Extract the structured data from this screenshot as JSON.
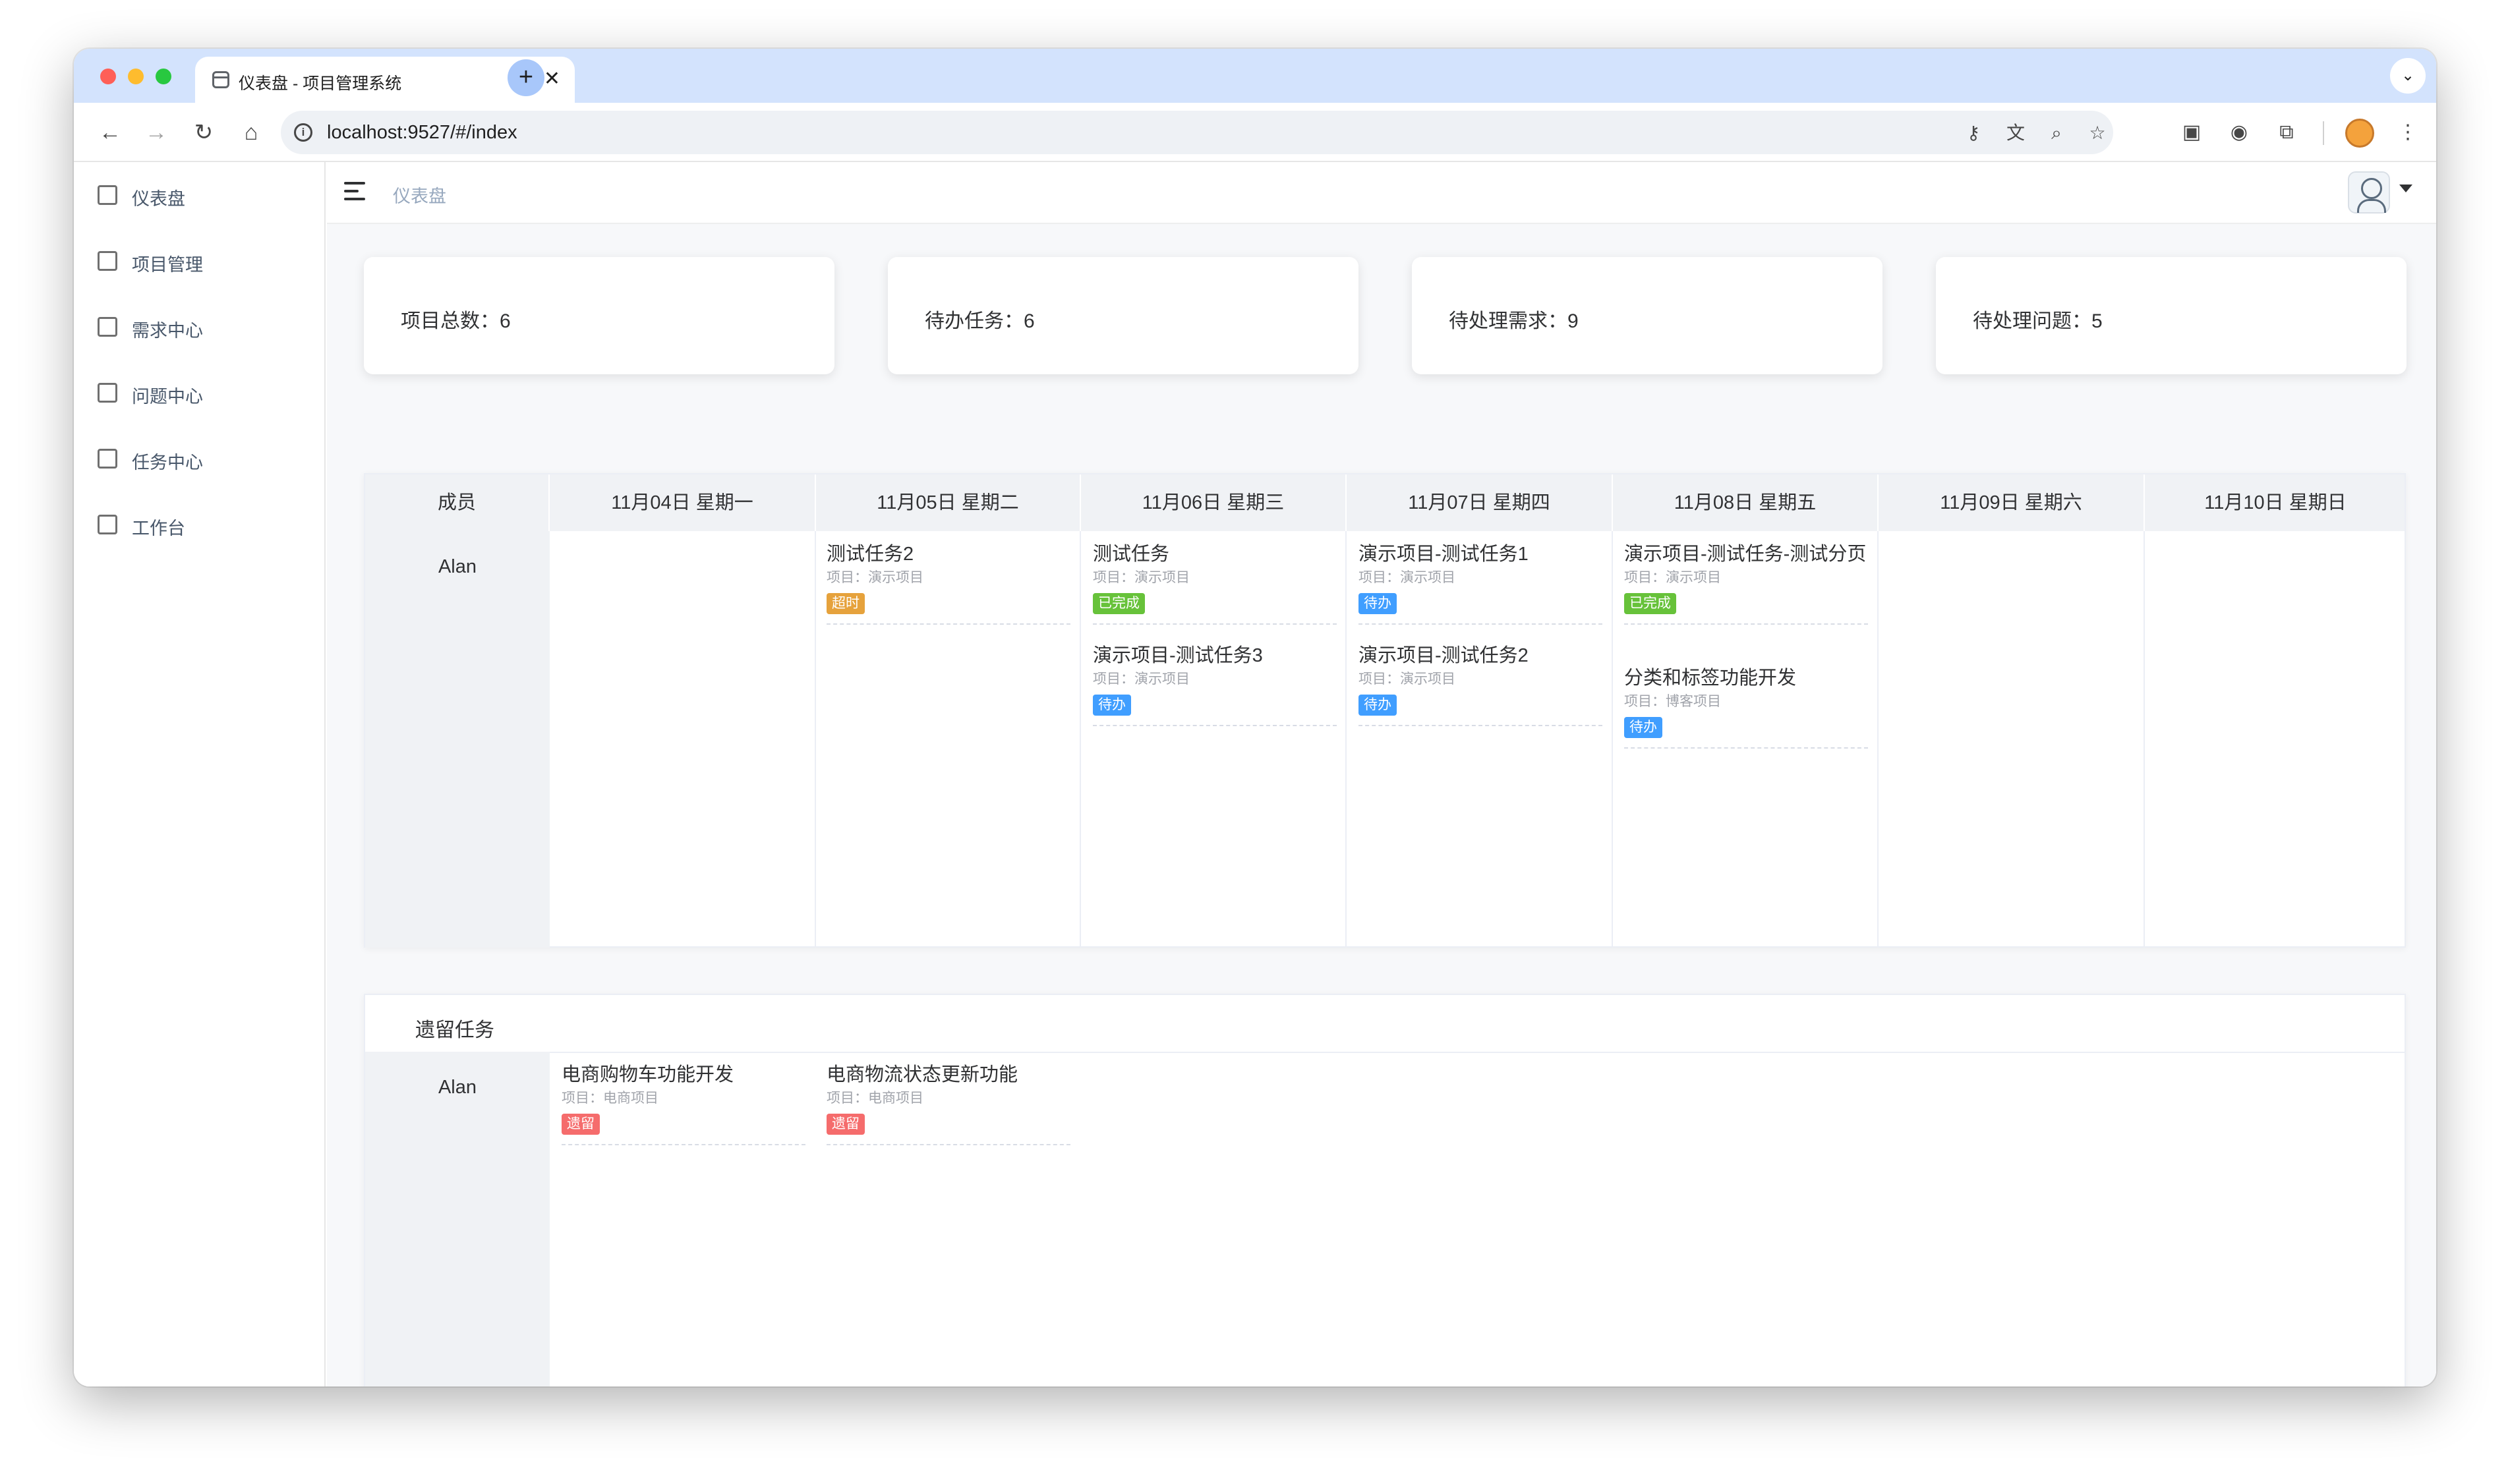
{
  "browser": {
    "tab_title": "仪表盘 - 项目管理系统",
    "url": "localhost:9527/#/index"
  },
  "sidebar": {
    "items": [
      {
        "label": "仪表盘",
        "icon": "dashboard-icon"
      },
      {
        "label": "项目管理",
        "icon": "briefcase-icon"
      },
      {
        "label": "需求中心",
        "icon": "archive-icon"
      },
      {
        "label": "问题中心",
        "icon": "document-icon"
      },
      {
        "label": "任务中心",
        "icon": "copy-icon"
      },
      {
        "label": "工作台",
        "icon": "workbench-icon"
      }
    ]
  },
  "navbar": {
    "breadcrumb": "仪表盘"
  },
  "stats": [
    {
      "label": "项目总数：6"
    },
    {
      "label": "待办任务：6"
    },
    {
      "label": "待处理需求：9"
    },
    {
      "label": "待处理问题：5"
    }
  ],
  "board": {
    "member_header": "成员",
    "days": [
      "11月04日 星期一",
      "11月05日 星期二",
      "11月06日 星期三",
      "11月07日 星期四",
      "11月08日 星期五",
      "11月09日 星期六",
      "11月10日 星期日"
    ],
    "member": "Alan",
    "tasks": [
      [],
      [
        {
          "title": "测试任务2",
          "project": "项目：演示项目",
          "status": "超时",
          "status_color": "#e6a23c"
        }
      ],
      [
        {
          "title": "测试任务",
          "project": "项目：演示项目",
          "status": "已完成",
          "status_color": "#67c23a"
        },
        {
          "title": "演示项目-测试任务3",
          "project": "项目：演示项目",
          "status": "待办",
          "status_color": "#409eff"
        }
      ],
      [
        {
          "title": "演示项目-测试任务1",
          "project": "项目：演示项目",
          "status": "待办",
          "status_color": "#409eff"
        },
        {
          "title": "演示项目-测试任务2",
          "project": "项目：演示项目",
          "status": "待办",
          "status_color": "#409eff"
        }
      ],
      [
        {
          "title": "演示项目-测试任务-测试分页",
          "project": "项目：演示项目",
          "status": "已完成",
          "status_color": "#67c23a"
        },
        {
          "title": "分类和标签功能开发",
          "project": "项目：博客项目",
          "status": "待办",
          "status_color": "#409eff"
        }
      ],
      [],
      []
    ]
  },
  "leftover": {
    "title": "遗留任务",
    "member": "Alan",
    "tasks": [
      {
        "title": "电商购物车功能开发",
        "project": "项目：电商项目",
        "status": "遗留",
        "status_color": "#f56c6c"
      },
      {
        "title": "电商物流状态更新功能",
        "project": "项目：电商项目",
        "status": "遗留",
        "status_color": "#f56c6c"
      }
    ]
  }
}
